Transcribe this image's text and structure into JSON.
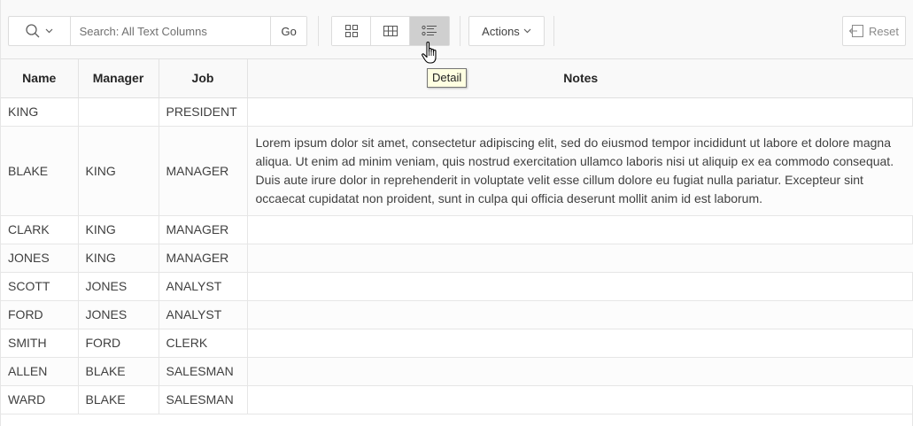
{
  "toolbar": {
    "search_icon": "magnifier-icon",
    "search_placeholder": "Search: All Text Columns",
    "search_value": "",
    "go_label": "Go",
    "views": [
      {
        "name": "icon-view",
        "icon": "grid-icon",
        "active": false
      },
      {
        "name": "report-view",
        "icon": "table-icon",
        "active": false
      },
      {
        "name": "detail-view",
        "icon": "detail-list-icon",
        "active": true
      }
    ],
    "actions_label": "Actions",
    "reset_label": "Reset"
  },
  "tooltip": "Detail",
  "table": {
    "columns": [
      "Name",
      "Manager",
      "Job",
      "Notes"
    ],
    "rows": [
      {
        "name": "KING",
        "manager": "",
        "job": "PRESIDENT",
        "notes": ""
      },
      {
        "name": "BLAKE",
        "manager": "KING",
        "job": "MANAGER",
        "notes": "Lorem ipsum dolor sit amet, consectetur adipiscing elit, sed do eiusmod tempor incididunt ut labore et dolore magna aliqua. Ut enim ad minim veniam, quis nostrud exercitation ullamco laboris nisi ut aliquip ex ea commodo consequat. Duis aute irure dolor in reprehenderit in voluptate velit esse cillum dolore eu fugiat nulla pariatur. Excepteur sint occaecat cupidatat non proident, sunt in culpa qui officia deserunt mollit anim id est laborum."
      },
      {
        "name": "CLARK",
        "manager": "KING",
        "job": "MANAGER",
        "notes": ""
      },
      {
        "name": "JONES",
        "manager": "KING",
        "job": "MANAGER",
        "notes": ""
      },
      {
        "name": "SCOTT",
        "manager": "JONES",
        "job": "ANALYST",
        "notes": ""
      },
      {
        "name": "FORD",
        "manager": "JONES",
        "job": "ANALYST",
        "notes": ""
      },
      {
        "name": "SMITH",
        "manager": "FORD",
        "job": "CLERK",
        "notes": ""
      },
      {
        "name": "ALLEN",
        "manager": "BLAKE",
        "job": "SALESMAN",
        "notes": ""
      },
      {
        "name": "WARD",
        "manager": "BLAKE",
        "job": "SALESMAN",
        "notes": ""
      }
    ]
  }
}
